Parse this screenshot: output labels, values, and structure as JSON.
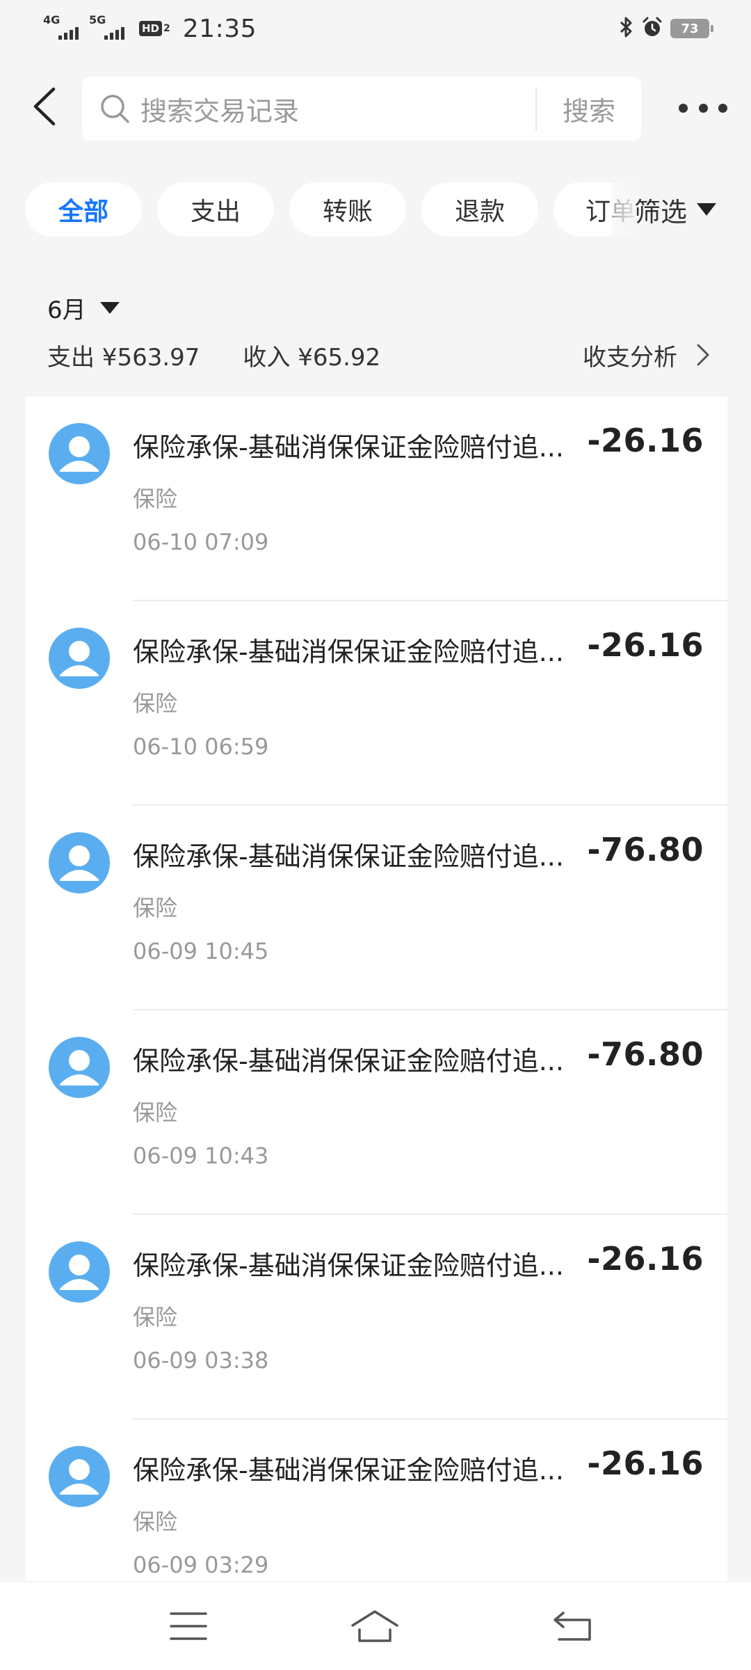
{
  "status_bar": {
    "network1": "4G",
    "network2": "5G",
    "hd_label": "HD",
    "hd_sub": "2",
    "time": "21:35",
    "battery": "73"
  },
  "header": {
    "search_placeholder": "搜索交易记录",
    "search_button": "搜索"
  },
  "filters": {
    "chips": [
      {
        "label": "全部",
        "active": true
      },
      {
        "label": "支出",
        "active": false
      },
      {
        "label": "转账",
        "active": false
      },
      {
        "label": "退款",
        "active": false
      },
      {
        "label": "订单",
        "active": false
      }
    ],
    "filter_label": "筛选"
  },
  "summary": {
    "month": "6月",
    "expense": "支出 ¥563.97",
    "income": "收入 ¥65.92",
    "analysis_link": "收支分析"
  },
  "transactions": [
    {
      "title": "保险承保-基础消保保证金险赔付追...",
      "category": "保险",
      "time": "06-10 07:09",
      "amount": "-26.16"
    },
    {
      "title": "保险承保-基础消保保证金险赔付追...",
      "category": "保险",
      "time": "06-10 06:59",
      "amount": "-26.16"
    },
    {
      "title": "保险承保-基础消保保证金险赔付追...",
      "category": "保险",
      "time": "06-09 10:45",
      "amount": "-76.80"
    },
    {
      "title": "保险承保-基础消保保证金险赔付追...",
      "category": "保险",
      "time": "06-09 10:43",
      "amount": "-76.80"
    },
    {
      "title": "保险承保-基础消保保证金险赔付追...",
      "category": "保险",
      "time": "06-09 03:38",
      "amount": "-26.16"
    },
    {
      "title": "保险承保-基础消保保证金险赔付追...",
      "category": "保险",
      "time": "06-09 03:29",
      "amount": "-26.16"
    }
  ],
  "colors": {
    "accent": "#1677ff",
    "avatar": "#5aaef0",
    "background": "#f5f5f5"
  },
  "icons": {
    "back": "chevron-left-icon",
    "search": "search-icon",
    "more": "more-dots-icon",
    "avatar": "user-icon",
    "nav_menu": "menu-icon",
    "nav_home": "home-icon",
    "nav_back": "back-icon"
  }
}
